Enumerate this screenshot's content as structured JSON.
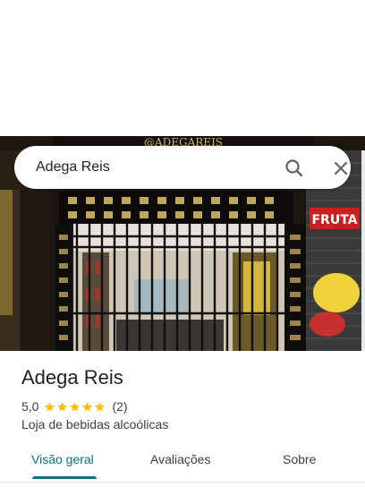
{
  "search": {
    "query": "Adega Reis"
  },
  "photo": {
    "sign_text": "@ADEGAREIS",
    "side_sign_text": "FRUTA"
  },
  "place": {
    "name": "Adega Reis",
    "rating": "5,0",
    "stars": 5,
    "review_count": "(2)",
    "category": "Loja de bebidas alcoólicas"
  },
  "tabs": [
    {
      "label": "Visão geral",
      "active": true
    },
    {
      "label": "Avaliações",
      "active": false
    },
    {
      "label": "Sobre",
      "active": false
    }
  ],
  "colors": {
    "accent": "#0b7285",
    "star": "#fbbc04"
  },
  "icons": {
    "search": "search-icon",
    "close": "close-icon"
  }
}
